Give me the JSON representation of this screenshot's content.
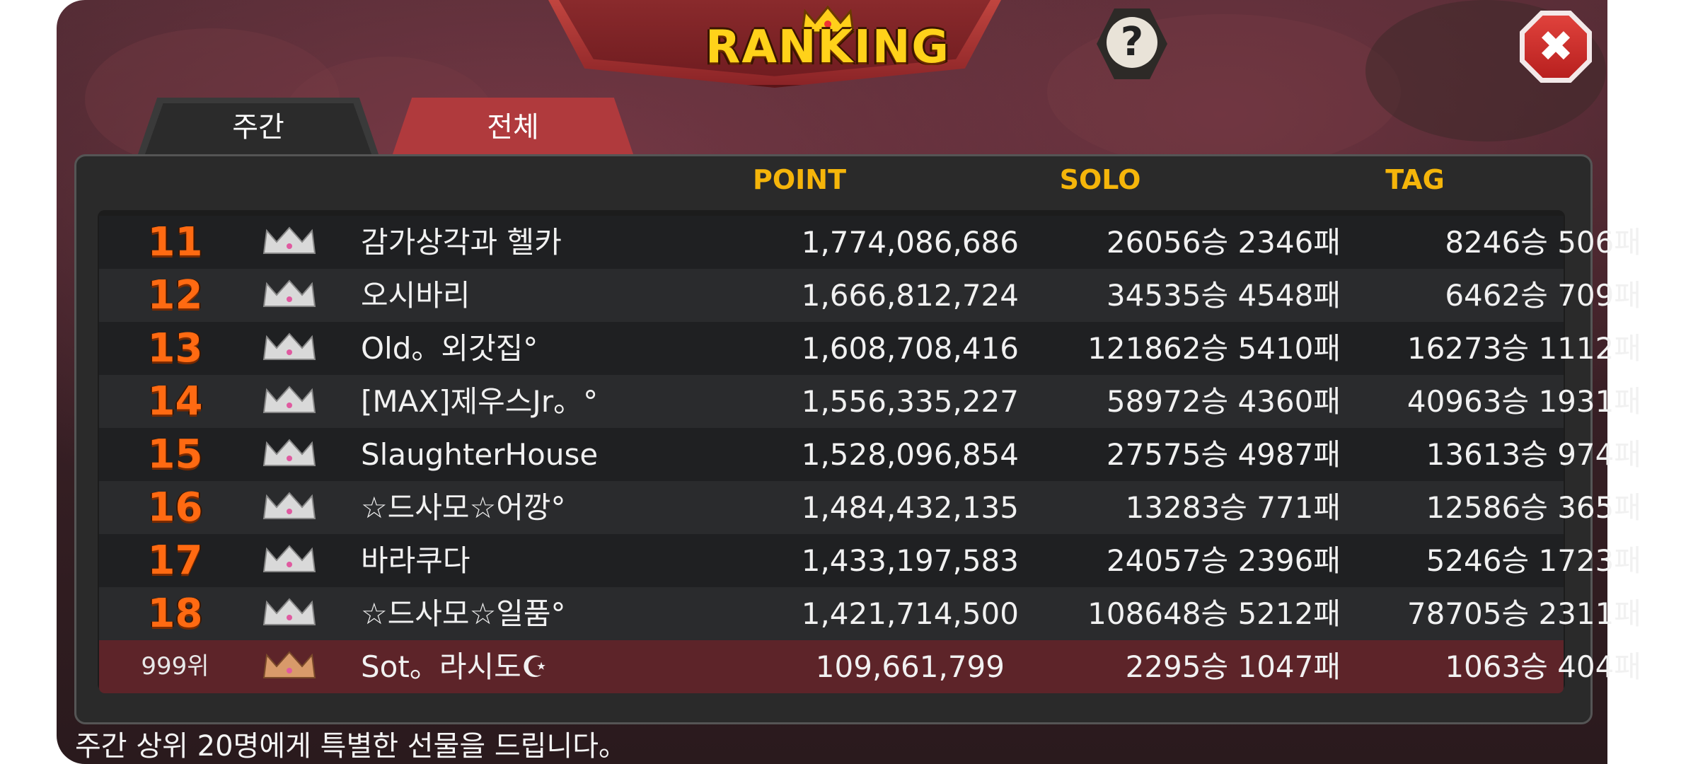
{
  "title": "RANKING",
  "help_label": "?",
  "close_label": "✖",
  "tabs": [
    {
      "label": "주간",
      "active": true
    },
    {
      "label": "전체",
      "active": false
    }
  ],
  "columns": {
    "point": "POINT",
    "solo": "SOLO",
    "tag": "TAG"
  },
  "rows": [
    {
      "rank": "11",
      "name": "감가상각과 헬카",
      "point": "1,774,086,686",
      "solo": "26056승 2346패",
      "tag": "8246승 506패"
    },
    {
      "rank": "12",
      "name": "오시바리",
      "point": "1,666,812,724",
      "solo": "34535승 4548패",
      "tag": "6462승 709패"
    },
    {
      "rank": "13",
      "name": "Old。외갓집°",
      "point": "1,608,708,416",
      "solo": "121862승 5410패",
      "tag": "16273승 1112패"
    },
    {
      "rank": "14",
      "name": "[MAX]제우스Jr。°",
      "point": "1,556,335,227",
      "solo": "58972승 4360패",
      "tag": "40963승 1931패"
    },
    {
      "rank": "15",
      "name": "SlaughterHouse",
      "point": "1,528,096,854",
      "solo": "27575승 4987패",
      "tag": "13613승 974패"
    },
    {
      "rank": "16",
      "name": "☆드사모☆어깡°",
      "point": "1,484,432,135",
      "solo": "13283승 771패",
      "tag": "12586승 365패"
    },
    {
      "rank": "17",
      "name": "바라쿠다",
      "point": "1,433,197,583",
      "solo": "24057승 2396패",
      "tag": "5246승 1723패"
    },
    {
      "rank": "18",
      "name": "☆드사모☆일품°",
      "point": "1,421,714,500",
      "solo": "108648승 5212패",
      "tag": "78705승 2311패"
    }
  ],
  "my_row": {
    "rank": "999위",
    "name": "Sot。라시도☪",
    "point": "109,661,799",
    "solo": "2295승 1047패",
    "tag": "1063승 404패"
  },
  "footer": "주간 상위 20명에게 특별한 선물을 드립니다。",
  "colors": {
    "accent": "#f5b50a",
    "rank": "#ff6a12",
    "banner": "#8b2427",
    "my_row": "#5d2429"
  }
}
